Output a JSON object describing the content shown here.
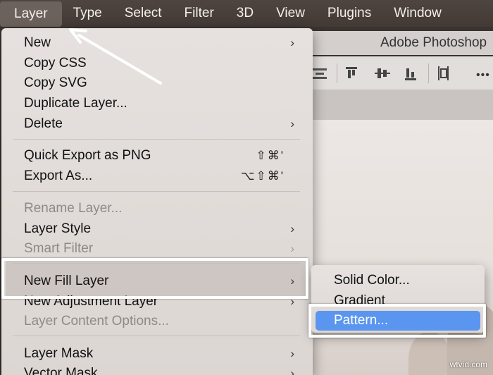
{
  "menubar": {
    "items": [
      "Layer",
      "Type",
      "Select",
      "Filter",
      "3D",
      "View",
      "Plugins",
      "Window"
    ]
  },
  "app": {
    "title": "Adobe Photoshop"
  },
  "menu": {
    "items": [
      {
        "label": "New",
        "submenu": true
      },
      {
        "label": "Copy CSS"
      },
      {
        "label": "Copy SVG"
      },
      {
        "label": "Duplicate Layer..."
      },
      {
        "label": "Delete",
        "submenu": true
      },
      {
        "label": "Quick Export as PNG",
        "shortcut": "⇧⌘'"
      },
      {
        "label": "Export As...",
        "shortcut": "⌥⇧⌘'"
      },
      {
        "label": "Rename Layer...",
        "disabled": true
      },
      {
        "label": "Layer Style",
        "submenu": true
      },
      {
        "label": "Smart Filter",
        "submenu": true,
        "disabled": true
      },
      {
        "label": "New Fill Layer",
        "submenu": true,
        "highlighted": true
      },
      {
        "label": "New Adjustment Layer",
        "submenu": true
      },
      {
        "label": "Layer Content Options...",
        "disabled": true
      },
      {
        "label": "Layer Mask",
        "submenu": true
      },
      {
        "label": "Vector Mask",
        "submenu": true
      }
    ],
    "chevron": "›"
  },
  "submenu": {
    "items": [
      "Solid Color...",
      "Gradient",
      "Pattern..."
    ],
    "selected": "Pattern..."
  },
  "watermark": "wtvid.com",
  "colors": {
    "menubar": "#463c38",
    "menu_bg": "#e3dedb",
    "selection": "#5a96ef",
    "annotation": "#ffffff"
  }
}
